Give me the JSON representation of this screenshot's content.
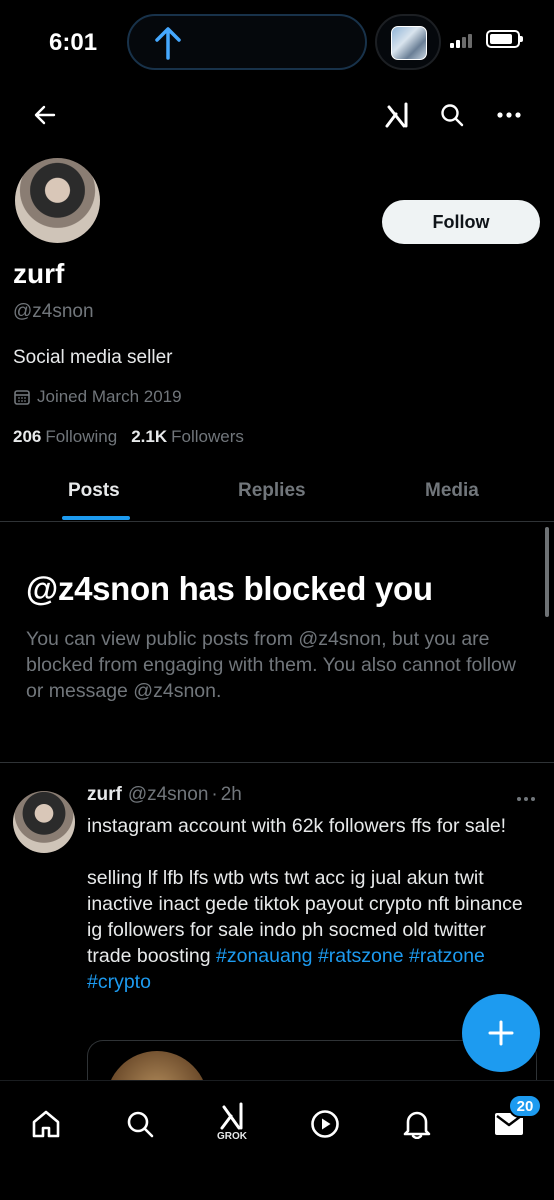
{
  "status_bar": {
    "time": "6:01"
  },
  "profile": {
    "display_name": "zurf",
    "handle": "@z4snon",
    "bio": "Social media seller",
    "joined": "Joined March 2019",
    "following_count": "206",
    "following_label": "Following",
    "followers_count": "2.1K",
    "followers_label": "Followers",
    "follow_label": "Follow"
  },
  "tabs": [
    {
      "label": "Posts",
      "active": true
    },
    {
      "label": "Replies",
      "active": false
    },
    {
      "label": "Media",
      "active": false
    }
  ],
  "blocked": {
    "title": "@z4snon has blocked you",
    "message": "You can view public posts from @z4snon, but you are blocked from engaging with them. You also cannot follow or message @z4snon."
  },
  "post": {
    "author": "zurf",
    "handle": "@z4snon",
    "separator": "·",
    "time": "2h",
    "line1": "instagram account with 62k followers ffs for sale!",
    "line2": "selling lf lfb lfs wtb wts twt acc ig jual akun twit inactive inact gede tiktok payout crypto nft binance ig followers for sale indo ph socmed old twitter trade boosting",
    "hashtags": [
      "#zonauang",
      "#ratszone",
      "#ratzone",
      "#crypto"
    ]
  },
  "bottom_nav": {
    "grok_label": "GROK",
    "messages_badge": "20"
  },
  "colors": {
    "accent": "#1d9bf0",
    "background": "#000000",
    "muted": "#71767b"
  }
}
